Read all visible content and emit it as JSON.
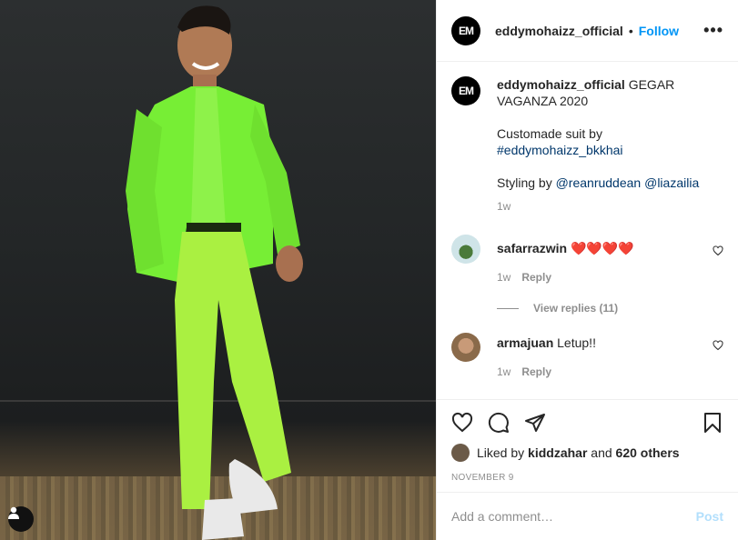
{
  "header": {
    "avatar_text": "EM",
    "username": "eddymohaizz_official",
    "separator": "•",
    "follow_label": "Follow",
    "more_label": "•••"
  },
  "caption": {
    "username": "eddymohaizz_official",
    "line1": "GEGAR VAGANZA 2020",
    "line2": "Customade suit by",
    "hashtag": "#eddymohaizz_bkkhai",
    "styling_prefix": "Styling by",
    "mention1": "@reanruddean",
    "mention2": "@liazailia",
    "time": "1w"
  },
  "comments": [
    {
      "username": "safarrazwin",
      "text": "❤️❤️❤️❤️",
      "time": "1w",
      "reply_label": "Reply"
    },
    {
      "username": "armajuan",
      "text": "Letup!!",
      "time": "1w",
      "reply_label": "Reply"
    }
  ],
  "view_replies": "View replies (11)",
  "likes": {
    "prefix": "Liked by",
    "user": "kiddzahar",
    "middle": "and",
    "others": "620 others"
  },
  "date": "NOVEMBER 9",
  "add_comment": {
    "placeholder": "Add a comment…",
    "post_label": "Post"
  },
  "colors": {
    "link": "#00376b",
    "follow": "#0095f6",
    "post_disabled": "#b2dffc",
    "suit": "#7cf23a"
  },
  "icons": [
    "user-tag-icon",
    "heart-icon",
    "comment-icon",
    "share-icon",
    "bookmark-icon",
    "more-icon"
  ]
}
